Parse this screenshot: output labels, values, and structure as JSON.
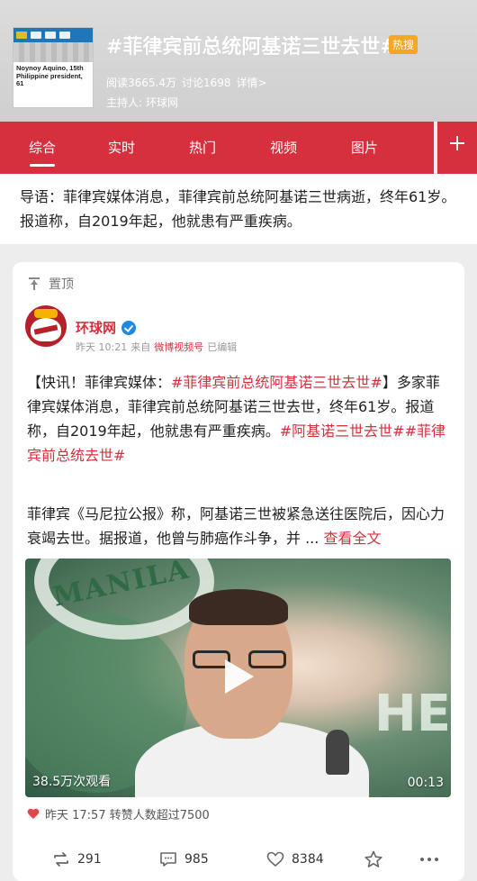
{
  "header": {
    "thumb_caption": "Noynoy Aquino, 15th Philippine president, 61",
    "title": "#菲律宾前总统阿基诺三世去世#",
    "hot_badge": "热搜",
    "reads": "阅读3665.4万",
    "discussions": "讨论1698",
    "details": "详情>",
    "host_label": "主持人:",
    "host_name": "环球网"
  },
  "tabs": [
    {
      "label": "综合"
    },
    {
      "label": "实时"
    },
    {
      "label": "热门"
    },
    {
      "label": "视频"
    },
    {
      "label": "图片"
    }
  ],
  "intro": "导语：菲律宾媒体消息，菲律宾前总统阿基诺三世病逝，终年61岁。报道称，自2019年起，他就患有严重疾病。",
  "post": {
    "pinned_label": "置顶",
    "author": "环球网",
    "time": "昨天 10:21",
    "from_label": "来自",
    "source": "微博视频号",
    "edited": "已编辑",
    "text_prefix": "【快讯！菲律宾媒体：",
    "tag1": "#菲律宾前总统阿基诺三世去世#",
    "text_mid": "】多家菲律宾媒体消息，菲律宾前总统阿基诺三世去世，终年61岁。报道称，自2019年起，他就患有严重疾病。",
    "tag2": "#阿基诺三世去世#",
    "tag3": "#菲律宾前总统去世#",
    "text2": "菲律宾《马尼拉公报》称，阿基诺三世被紧急送往医院后，因心力衰竭去世。据报道，他曾与肺癌作斗争，并 ...",
    "more": "查看全文",
    "video": {
      "sign_text": "MANILA",
      "sign_text2": "HE",
      "views": "38.5万次观看",
      "duration": "00:13"
    },
    "likes_summary": "昨天 17:57 转赞人数超过7500",
    "reposts": "291",
    "comments": "985",
    "likes": "8384"
  },
  "colors": {
    "accent": "#d6303e",
    "hot_badge": "#f5a623",
    "verified": "#1e8ae0"
  }
}
